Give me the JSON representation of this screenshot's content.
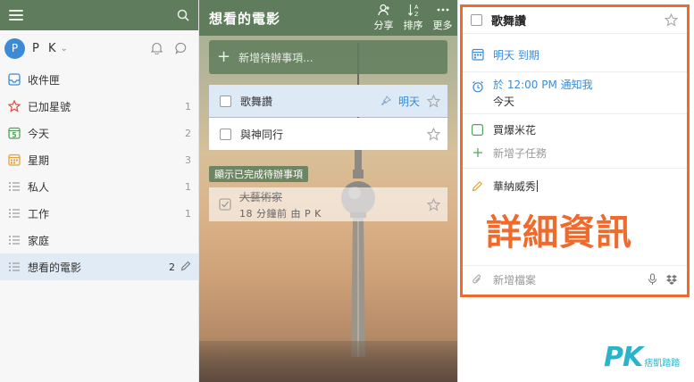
{
  "sidebar": {
    "user": {
      "initial": "P",
      "name": "P K"
    },
    "items": [
      {
        "label": "收件匣",
        "count": "",
        "icon": "inbox-icon"
      },
      {
        "label": "已加星號",
        "count": "1",
        "icon": "star-icon"
      },
      {
        "label": "今天",
        "count": "2",
        "icon": "calendar-today-icon",
        "day": "5"
      },
      {
        "label": "星期",
        "count": "3",
        "icon": "calendar-week-icon"
      },
      {
        "label": "私人",
        "count": "1",
        "icon": "list-icon"
      },
      {
        "label": "工作",
        "count": "1",
        "icon": "list-icon"
      },
      {
        "label": "家庭",
        "count": "",
        "icon": "list-icon"
      },
      {
        "label": "想看的電影",
        "count": "2",
        "icon": "list-icon",
        "active": true
      }
    ]
  },
  "main": {
    "title": "想看的電影",
    "actions": [
      {
        "label": "分享",
        "icon": "share-user-icon"
      },
      {
        "label": "排序",
        "icon": "sort-az-icon"
      },
      {
        "label": "更多",
        "icon": "more-dots-icon"
      }
    ],
    "add_placeholder": "新增待辦事項...",
    "tasks": [
      {
        "title": "歌舞讚",
        "due": "明天",
        "selected": true
      },
      {
        "title": "與神同行",
        "due": ""
      }
    ],
    "show_completed_label": "顯示已完成待辦事項",
    "completed": [
      {
        "title": "大藝術家",
        "meta": "18 分鐘前 由 P K"
      }
    ]
  },
  "detail": {
    "title": "歌舞讚",
    "due": "明天 到期",
    "reminder_line1": "於 12:00 PM 通知我",
    "reminder_line2": "今天",
    "subtask": "買爆米花",
    "add_subtask": "新增子任務",
    "note": "華納威秀",
    "add_file": "新增檔案"
  },
  "overlay_label": "詳細資訊",
  "watermark": {
    "logo": "PK",
    "sub": "痞凱踏踏"
  },
  "colors": {
    "accent": "#3b8bd6",
    "header_green": "#5f7d5c",
    "highlight_orange": "#f06a2b",
    "star_red": "#e04b3b"
  }
}
